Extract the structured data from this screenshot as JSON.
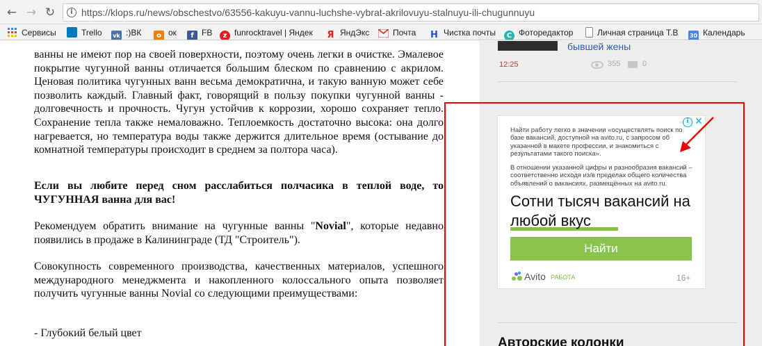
{
  "browser": {
    "url": "https://klops.ru/news/obschestvo/63556-kakuyu-vannu-luchshe-vybrat-akrilovuyu-stalnuyu-ili-chugunnuyu",
    "bookmarks": [
      {
        "label": "Сервисы",
        "icon": "apps-grid-icon",
        "color": "#4285f4"
      },
      {
        "label": "Trello",
        "icon": "trello-icon",
        "color": "#0079bf"
      },
      {
        "label": ":)ВК",
        "icon": "vk-icon",
        "color": "#4c75a3"
      },
      {
        "label": "ок",
        "icon": "odnoklassniki-icon",
        "color": "#ee8208"
      },
      {
        "label": "FB",
        "icon": "facebook-icon",
        "color": "#3b5998"
      },
      {
        "label": "funrocktravel | Яндек",
        "icon": "funrock-icon",
        "color": "#e02020"
      },
      {
        "label": "ЯндЭкс",
        "icon": "yandex-icon",
        "color": "#e02020"
      },
      {
        "label": "Почта",
        "icon": "mail-icon",
        "color": "#d44638"
      },
      {
        "label": "Чистка почты",
        "icon": "cleanup-icon",
        "color": "#2255cc"
      },
      {
        "label": "Фоторедактор",
        "icon": "photo-editor-icon",
        "color": "#2ab5b5"
      },
      {
        "label": "Личная страница Т.В",
        "icon": "page-icon",
        "color": "#888888"
      },
      {
        "label": "Календарь",
        "icon": "calendar-icon",
        "color": "#4a86e8"
      }
    ]
  },
  "article": {
    "paragraphs": [
      "ванны не имеют пор на своей поверхности, поэтому очень легки в очистке. Эмалевое покрытие чугунной ванны отличается большим блеском по сравнению с акрилом. Ценовая политика чугунных ванн весьма демократична, и такую ванную может себе позволить каждый. Главный факт, говорящий в пользу покупки чугунной ванны - долговечность и прочность. Чугун устойчив к коррозии, хорошо сохраняет тепло. Сохранение тепла также немаловажно. Теплоемкость достаточно высока: она долго нагревается, но температура воды также держится длительное время (остывание до комнатной температуры происходит в среднем за полтора часа)."
    ],
    "bold_paragraph": "Если вы любите перед сном расслабиться полчасика в теплой воде, то ЧУГУННАЯ ванна для вас!",
    "novial": {
      "before": "Рекомендуем обратить внимание на чугунные ванны \"",
      "brand": "Novial",
      "after": "\", которые недавно появились в продаже в Калининграде (ТД \"Строитель\")."
    },
    "paragraph_4": "Совокупность современного производства, качественных материалов, успешного международного менеджмента и накопленного колоссального опыта позволяет получить чугунные ванны Novial со следующими преимуществами:",
    "list_item_1": "- Глубокий белый цвет"
  },
  "sidebar": {
    "news_title": "бывшей жены",
    "news_time": "12:25",
    "news_views": "355",
    "news_comments": "0",
    "section_heading": "Авторские колонки"
  },
  "ad": {
    "small_text_1": "Найти работу легко в значении «осуществлять поиск по базе вакансий, доступной на avito.ru, с запросом об указанной в макете профессии, и знакомиться с результатами такого поиска».",
    "small_text_2": "В отношении указанной цифры и разнообразия вакансий – соответственно исходя из/в пределах общего количества объявлений о вакансиях, размещённых на avito.ru.",
    "headline": "Сотни тысяч вакансий на любой вкус",
    "button_label": "Найти",
    "brand": "Avito",
    "brand_sub": "РАБОТА",
    "age_rating": "16+",
    "colors": {
      "accent_green": "#8ac34d",
      "highlight_frame": "#e00000"
    }
  }
}
